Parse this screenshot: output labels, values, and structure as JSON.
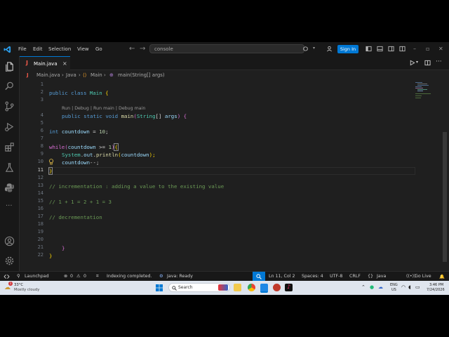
{
  "titlebar": {
    "menu": [
      "File",
      "Edit",
      "Selection",
      "View",
      "Go"
    ],
    "search_text": "console",
    "signin_label": "Sign In"
  },
  "tab": {
    "icon_letter": "J",
    "label": "Main.java",
    "close": "×"
  },
  "breadcrumb": {
    "items": [
      "Main.java",
      "Java",
      "Main",
      "main(String[] args)"
    ],
    "separator": "›"
  },
  "editor": {
    "line_numbers": [
      "1",
      "2",
      "3",
      "",
      "4",
      "5",
      "6",
      "7",
      "8",
      "9",
      "10",
      "11",
      "12",
      "13",
      "14",
      "15",
      "16",
      "17",
      "18",
      "19",
      "20",
      "21",
      "22"
    ],
    "codelens": "Run | Debug | Run main | Debug main",
    "code": {
      "l2": {
        "kw1": "public",
        "kw2": "class",
        "cls": "Main",
        "br": "{"
      },
      "l4": {
        "kw1": "public",
        "kw2": "static",
        "kw3": "void",
        "fn": "main",
        "p1": "(",
        "ty": "String",
        "p2": "[] ",
        "arg": "args",
        "p3": ")",
        "br": "{"
      },
      "l6": {
        "kw": "int",
        "var": "countdown",
        "op": " = ",
        "num": "10",
        "semi": ";"
      },
      "l8": {
        "kw": "while",
        "p1": "(",
        "var": "countdown",
        "op": " >= ",
        "num": "1",
        "p2": ")",
        "br": "{"
      },
      "l9": {
        "obj": "System",
        "d1": ".",
        "fld": "out",
        "d2": ".",
        "fn": "println",
        "p1": "(",
        "var": "countdown",
        "p2": ");"
      },
      "l10": {
        "var": "countdown",
        "op": "--;"
      },
      "l11": {
        "br": "}"
      },
      "l13": "// incrementation : adding a value to the existing value",
      "l15": "// 1 + 1 = 2 + 1 = 3",
      "l17": "// decrementation",
      "l21": {
        "br": "}"
      },
      "l22": {
        "br": "}"
      }
    }
  },
  "statusbar": {
    "errors": "0",
    "warnings": "0",
    "launchpad": "Launchpad",
    "indexing": "Indexing completed.",
    "java_status": "Java: Ready",
    "cursor": "Ln 11, Col 2",
    "spaces": "Spaces: 4",
    "encoding": "UTF-8",
    "eol": "CRLF",
    "language": "Java",
    "golive": "Go Live"
  },
  "taskbar": {
    "weather_temp": "33°C",
    "weather_desc": "Mostly cloudy",
    "search_label": "Search",
    "lang": "ENG",
    "region": "US",
    "time": "3:46 PM",
    "date": "7/24/2026"
  },
  "colors": {
    "accent": "#0078d4",
    "editor_bg": "#1f1f1f",
    "chrome_bg": "#181818"
  }
}
